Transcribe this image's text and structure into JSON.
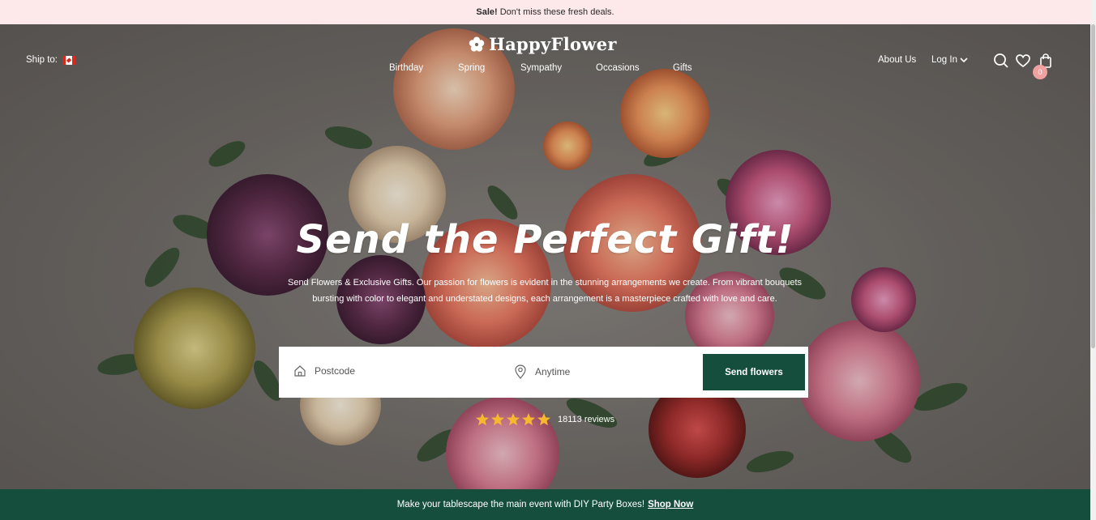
{
  "announcement": {
    "bold": "Sale!",
    "text": "Don't miss these fresh deals."
  },
  "header": {
    "ship_to_label": "Ship to:",
    "flag": "canada-flag-icon",
    "logo_text": "HappyFlower",
    "logo_icon": "flower-icon",
    "nav": [
      "Birthday",
      "Spring",
      "Sympathy",
      "Occasions",
      "Gifts"
    ],
    "about": "About Us",
    "login": "Log In",
    "icons": [
      "search-icon",
      "heart-icon",
      "cart-icon"
    ],
    "cart_count": "0"
  },
  "hero": {
    "headline": "Send the Perfect Gift!",
    "subtext": "Send Flowers & Exclusive Gifts. Our passion for flowers is evident in the stunning arrangements we create. From vibrant bouquets bursting with color to elegant and understated designs, each arrangement is a masterpiece crafted with love and care.",
    "postcode_placeholder": "Postcode",
    "date_placeholder": "Anytime",
    "send_button": "Send flowers",
    "rating_stars": 5,
    "reviews": "18113 reviews"
  },
  "promo": {
    "text": "Make your tablescape the main event with DIY Party Boxes!",
    "link": "Shop Now"
  },
  "colors": {
    "brand_green": "#154e3d",
    "announce_bg": "#fde8ea",
    "star": "#f5b82e",
    "badge": "#f0a2a0"
  }
}
